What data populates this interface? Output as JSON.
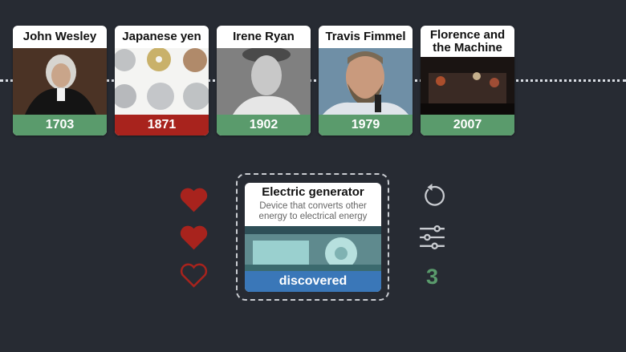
{
  "timeline": [
    {
      "title": "John Wesley",
      "year": "1703",
      "status": "correct"
    },
    {
      "title": "Japanese yen",
      "year": "1871",
      "status": "incorrect"
    },
    {
      "title": "Irene Ryan",
      "year": "1902",
      "status": "correct"
    },
    {
      "title": "Travis Fimmel",
      "year": "1979",
      "status": "correct"
    },
    {
      "title": "Florence and the Machine",
      "year": "2007",
      "status": "correct"
    }
  ],
  "current_card": {
    "title": "Electric generator",
    "description": "Device that converts other energy to electrical energy",
    "status": "discovered"
  },
  "lives": {
    "total": 3,
    "remaining": 2
  },
  "score": "3",
  "colors": {
    "background": "#272b33",
    "correct": "#5a9b6c",
    "incorrect": "#a8231d",
    "discovered": "#3a77b8",
    "heart": "#a8231d"
  },
  "icons": [
    "heart-icon",
    "restart-icon",
    "settings-sliders-icon"
  ]
}
